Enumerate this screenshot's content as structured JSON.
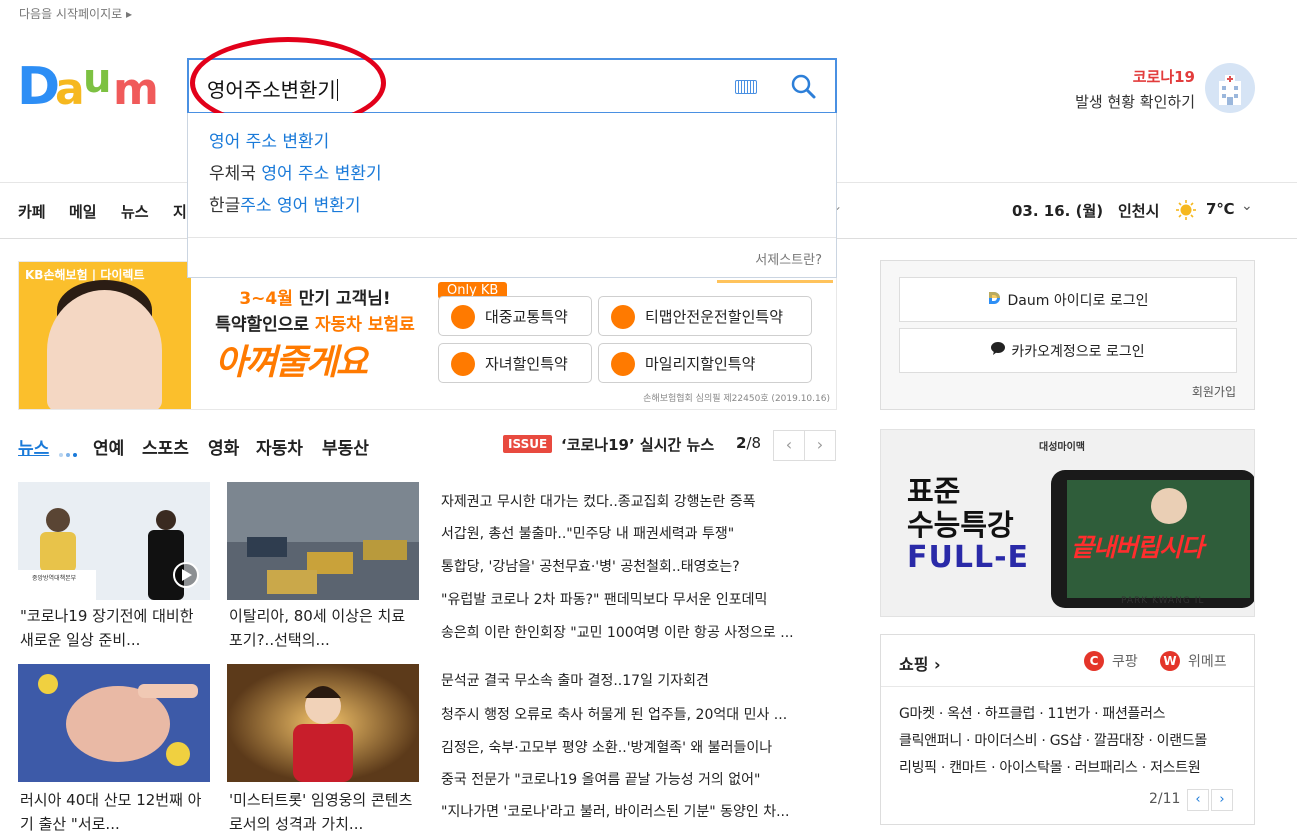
{
  "header": {
    "start_page_link": "다음을 시작페이지로 ▸",
    "logo_text": "Daum",
    "search": {
      "query": "영어주소변환기",
      "suggestions": [
        {
          "prefix": "",
          "match": "영어 주소 변환기",
          "suffix": ""
        },
        {
          "prefix": "우체국 ",
          "match": "영어 주소 변환기",
          "suffix": ""
        },
        {
          "prefix": "한글",
          "match": "주소 영어 변환기",
          "suffix": ""
        }
      ],
      "suggest_help": "서제스트란?"
    },
    "corona": {
      "title": "코로나19",
      "subtitle": "발생 현황 확인하기"
    }
  },
  "nav": {
    "items": [
      "카페",
      "메일",
      "뉴스",
      "지"
    ],
    "date": "03. 16. (월)",
    "city": "인천시",
    "temperature": "7℃",
    "dropdown_icon": "chevron-down-icon"
  },
  "ad": {
    "brand": "KB손해보험 | 다이렉트",
    "line1_highlight": "3~4월",
    "line1_rest": " 만기 고객님!",
    "line2_lead": "특약할인으로 ",
    "line2_highlight": "자동차 보험료",
    "line3": "아껴줄게요",
    "only_kb": "Only KB",
    "buttons": [
      "대중교통특약",
      "티맵안전운전할인특약",
      "자녀할인특약",
      "마일리지할인특약"
    ],
    "disclaimer": "손해보험협회 심의필 제22450호 (2019.10.16)"
  },
  "news": {
    "tabs": [
      "뉴스",
      "연예",
      "스포츠",
      "영화",
      "자동차",
      "부동산"
    ],
    "issue_badge": "ISSUE",
    "issue_title": "‘코로나19’ 실시간 뉴스",
    "page_current": "2",
    "page_total": "/8",
    "prev": "‹",
    "next": "›",
    "thumbs": [
      {
        "caption": "\"코로나19 장기전에 대비한 새로운 일상 준비..."
      },
      {
        "caption": "이탈리아, 80세 이상은 치료 포기?..선택의..."
      },
      {
        "caption": "러시아 40대 산모 12번째 아기 출산 \"서로..."
      },
      {
        "caption": "'미스터트롯' 임영웅의 콘텐츠로서의 성격과 가치..."
      }
    ],
    "headlines": [
      "자제권고 무시한 대가는 컸다..종교집회 강행논란 증폭",
      "서갑원, 총선 불출마..\"민주당 내 패권세력과 투쟁\"",
      "통합당, '강남을' 공천무효·'병' 공천철회..태영호는?",
      "\"유럽발 코로나 2차 파동?\" 팬데믹보다 무서운 인포데믹",
      "송은희 이란 한인회장 \"교민 100여명 이란 항공 사정으로 ...",
      "문석균 결국 무소속 출마 결정..17일 기자회견",
      "청주시 행정 오류로 축사 허물게 된 업주들, 20억대 민사 ...",
      "김정은, 숙부·고모부 평양 소환..'방계혈족' 왜 불러들이나",
      "중국 전문가 \"코로나19 올여름 끝날 가능성 거의 없어\"",
      "\"지나가면 '코로나'라고 불러, 바이러스된 기분\" 동양인 차..."
    ]
  },
  "login": {
    "daum_login": "Daum 아이디로 로그인",
    "kakao_login": "카카오계정으로 로그인",
    "join": "회원가입"
  },
  "side_ad": {
    "brand": "대성마이맥",
    "line1": "표준",
    "line2": "수능특강",
    "line3": "FULL-E",
    "slogan": "끝내버립시다",
    "teacher": "PARK KWANG IL"
  },
  "shopping": {
    "title": "쇼핑 ›",
    "partners": [
      {
        "badge": "C",
        "name": "쿠팡",
        "color": "#e4352a"
      },
      {
        "badge": "W",
        "name": "위메프",
        "color": "#e4352a"
      }
    ],
    "rows": [
      "G마켓 · 옥션 · 하프클럽 · 11번가 · 패션플러스",
      "클릭앤퍼니 · 마이더스비 · GS샵 · 깔끔대장 · 이랜드몰",
      "리빙픽 · 캔마트 · 아이스탁몰 · 러브패리스 · 저스트원"
    ],
    "page": "2/11",
    "prev": "‹",
    "next": "›"
  }
}
